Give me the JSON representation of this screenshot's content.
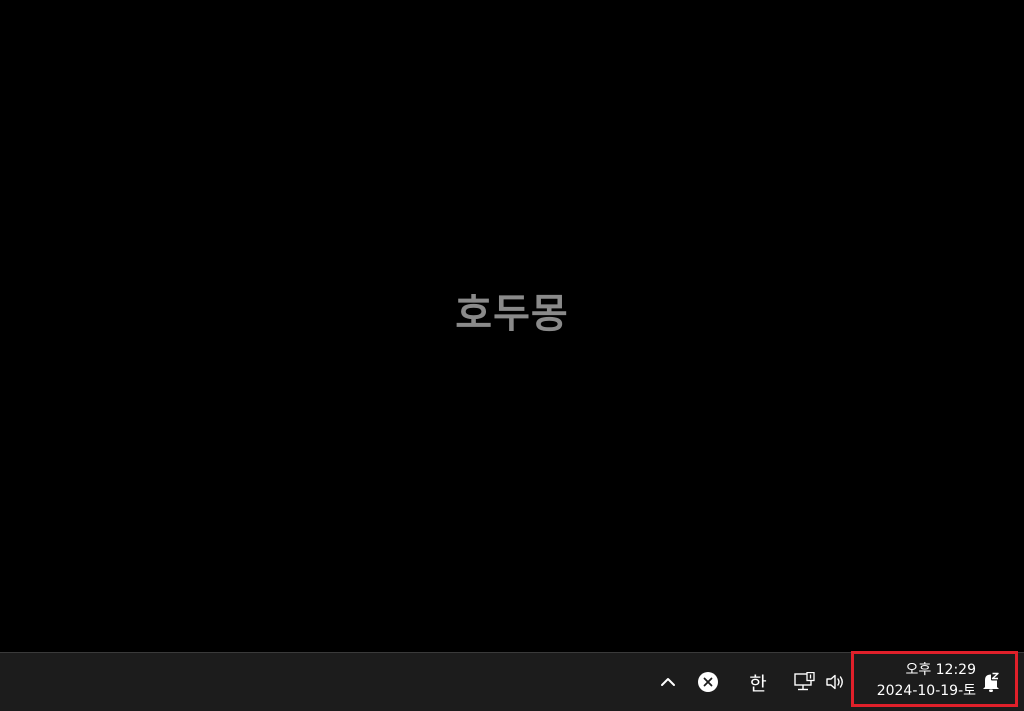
{
  "desktop": {
    "watermark_text": "호두몽"
  },
  "taskbar": {
    "tray": {
      "overflow_icon": "chevron-up-icon",
      "status_icon": "close-circle-icon",
      "ime_label": "한",
      "network_icon": "network-monitor-icon",
      "volume_icon": "speaker-icon",
      "notification_icon": "notification-bell-icon"
    },
    "clock": {
      "time": "오후 12:29",
      "date": "2024-10-19-토"
    }
  },
  "colors": {
    "background": "#000000",
    "taskbar": "#1c1c1c",
    "highlight_box": "#e0202a",
    "watermark": "#8a8a8a"
  }
}
